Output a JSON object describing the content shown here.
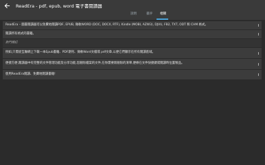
{
  "header": {
    "title": "ReadEra - pdf, epub, word 電子書閱讀器",
    "tabs": [
      {
        "label": "說明"
      },
      {
        "label": "書評"
      },
      {
        "label": "相關"
      }
    ]
  },
  "rows": [
    {
      "text": "ReadEra – 圖書閱讀器可以免費地閱讀PDF, EPUB, 微軟WORD (DOC, DOCX, RTF), Kindle (MOBI, AZW3), DJVU, FB2, TXT, ODT 和 CHM 格式。"
    },
    {
      "text": "閱讀所有格式的書籍。"
    },
    {
      "text": "熱門標記"
    },
    {
      "text": "例如,只需從互聯網上下載一本Epub書籍、PDF期刊、微軟Word文檔或 pdf文章,以便它們顯示在所有閱讀區域。"
    },
    {
      "text": "便捷方便,閱讀器中有完整的文件管理功能及分享功能,您刪除檔案的文件,在你需要新刪除的清單,便條在文件快捷鍵或閱讀時位置製品。"
    },
    {
      "text": "使用ReadEra閱讀、免費地閱讀書籍!"
    }
  ]
}
